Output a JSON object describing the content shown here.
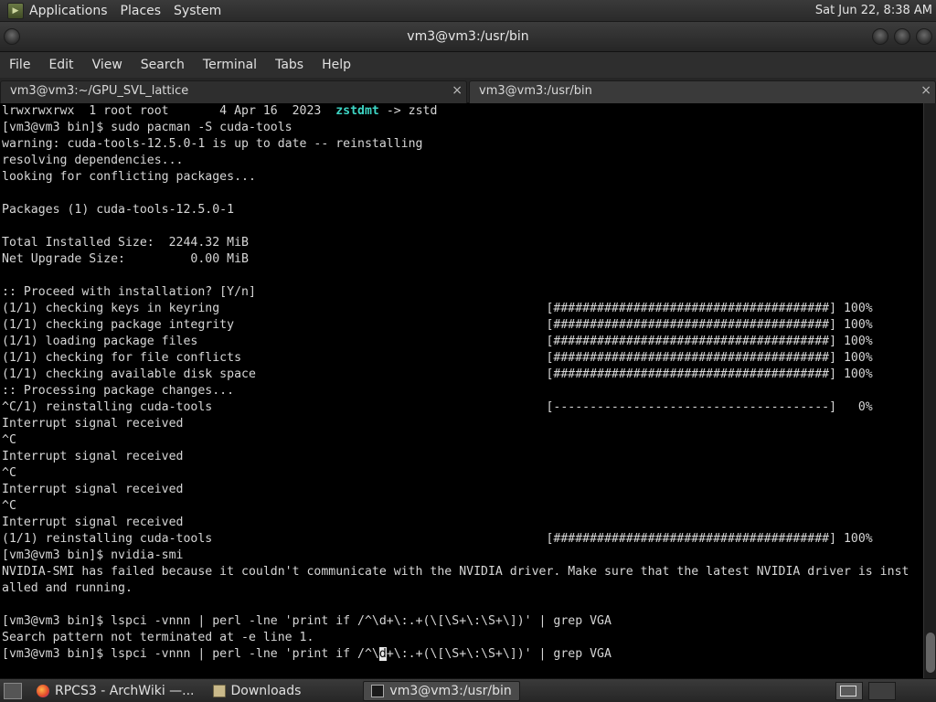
{
  "top_panel": {
    "menus": [
      "Applications",
      "Places",
      "System"
    ],
    "clock": "Sat Jun 22,  8:38 AM"
  },
  "window": {
    "title": "vm3@vm3:/usr/bin"
  },
  "menubar": [
    "File",
    "Edit",
    "View",
    "Search",
    "Terminal",
    "Tabs",
    "Help"
  ],
  "tabs": [
    {
      "label": "vm3@vm3:~/GPU_SVL_lattice",
      "close": "×"
    },
    {
      "label": "vm3@vm3:/usr/bin",
      "close": "×"
    }
  ],
  "terminal": {
    "lines": [
      {
        "pre": "lrwxrwxrwx  1 root root       4 Apr 16  2023  ",
        "hl": "zstdmt",
        "post": " -> zstd"
      },
      {
        "text": "[vm3@vm3 bin]$ sudo pacman -S cuda-tools"
      },
      {
        "text": "warning: cuda-tools-12.5.0-1 is up to date -- reinstalling"
      },
      {
        "text": "resolving dependencies..."
      },
      {
        "text": "looking for conflicting packages..."
      },
      {
        "text": ""
      },
      {
        "text": "Packages (1) cuda-tools-12.5.0-1"
      },
      {
        "text": ""
      },
      {
        "text": "Total Installed Size:  2244.32 MiB"
      },
      {
        "text": "Net Upgrade Size:         0.00 MiB"
      },
      {
        "text": ""
      },
      {
        "text": ":: Proceed with installation? [Y/n]"
      },
      {
        "text": "(1/1) checking keys in keyring                                             [######################################] 100%"
      },
      {
        "text": "(1/1) checking package integrity                                           [######################################] 100%"
      },
      {
        "text": "(1/1) loading package files                                                [######################################] 100%"
      },
      {
        "text": "(1/1) checking for file conflicts                                          [######################################] 100%"
      },
      {
        "text": "(1/1) checking available disk space                                        [######################################] 100%"
      },
      {
        "text": ":: Processing package changes..."
      },
      {
        "text": "^C/1) reinstalling cuda-tools                                              [--------------------------------------]   0%"
      },
      {
        "text": "Interrupt signal received"
      },
      {
        "text": "^C"
      },
      {
        "text": "Interrupt signal received"
      },
      {
        "text": "^C"
      },
      {
        "text": "Interrupt signal received"
      },
      {
        "text": "^C"
      },
      {
        "text": "Interrupt signal received"
      },
      {
        "text": "(1/1) reinstalling cuda-tools                                              [######################################] 100%"
      },
      {
        "text": "[vm3@vm3 bin]$ nvidia-smi"
      },
      {
        "text": "NVIDIA-SMI has failed because it couldn't communicate with the NVIDIA driver. Make sure that the latest NVIDIA driver is inst"
      },
      {
        "text": "alled and running."
      },
      {
        "text": ""
      },
      {
        "text": "[vm3@vm3 bin]$ lspci -vnnn | perl -lne 'print if /^\\d+\\:.+(\\[\\S+\\:\\S+\\])' | grep VGA"
      },
      {
        "text": "Search pattern not terminated at -e line 1."
      },
      {
        "pre": "[vm3@vm3 bin]$ lspci -vnnn | perl -lne 'print if /^\\",
        "cursor": "d",
        "post": "+\\:.+(\\[\\S+\\:\\S+\\])' | grep VGA"
      }
    ]
  },
  "taskbar": {
    "items": [
      {
        "label": "RPCS3 - ArchWiki —...",
        "icon": "firefox-icon"
      },
      {
        "label": "Downloads",
        "icon": "folder-icon"
      },
      {
        "label": "vm3@vm3:/usr/bin",
        "icon": "terminal-icon"
      }
    ]
  }
}
